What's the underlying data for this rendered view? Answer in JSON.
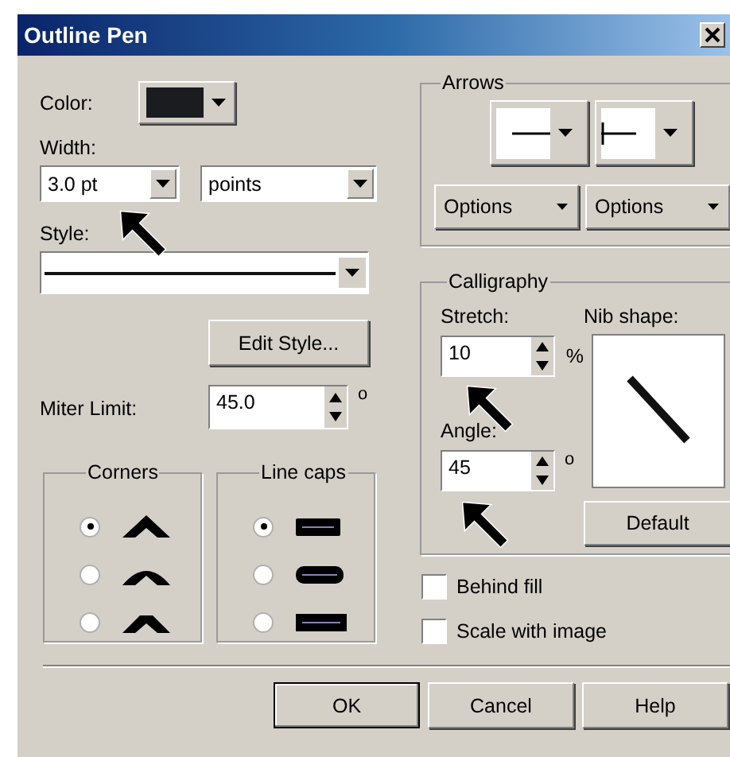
{
  "window": {
    "title": "Outline Pen"
  },
  "color": {
    "label": "Color:"
  },
  "width": {
    "label": "Width:",
    "value": "3.0 pt",
    "unit": "points"
  },
  "style": {
    "label": "Style:"
  },
  "edit_style_button": "Edit Style...",
  "miter_limit": {
    "label": "Miter Limit:",
    "value": "45.0",
    "unit": "o"
  },
  "corners": {
    "title": "Corners",
    "options": [
      {
        "kind": "miter",
        "selected": true
      },
      {
        "kind": "round",
        "selected": false
      },
      {
        "kind": "bevel",
        "selected": false
      }
    ]
  },
  "line_caps": {
    "title": "Line caps",
    "options": [
      {
        "kind": "butt",
        "selected": true
      },
      {
        "kind": "round",
        "selected": false
      },
      {
        "kind": "square",
        "selected": false
      }
    ]
  },
  "arrows": {
    "title": "Arrows",
    "options_buttons": [
      "Options",
      "Options"
    ]
  },
  "calligraphy": {
    "title": "Calligraphy",
    "stretch": {
      "label": "Stretch:",
      "value": "10",
      "unit": "%"
    },
    "nib_shape": {
      "label": "Nib shape:"
    },
    "angle": {
      "label": "Angle:",
      "value": "45",
      "unit": "o"
    },
    "default_button": "Default"
  },
  "checkboxes": [
    {
      "label": "Behind fill",
      "checked": false
    },
    {
      "label": "Scale with image",
      "checked": false
    }
  ],
  "buttons": [
    {
      "label": "OK",
      "default": true
    },
    {
      "label": "Cancel",
      "default": false
    },
    {
      "label": "Help",
      "default": false
    }
  ]
}
